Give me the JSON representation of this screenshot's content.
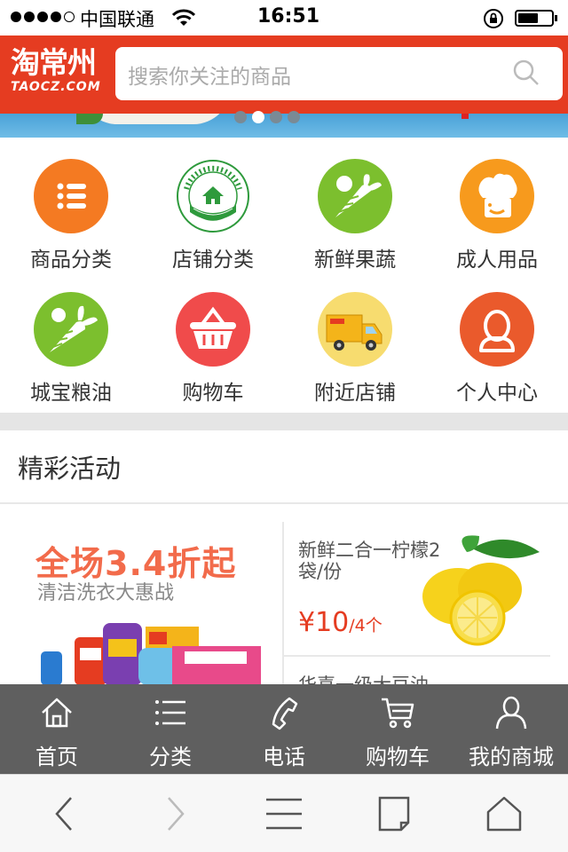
{
  "status_bar": {
    "carrier": "中国联通",
    "time": "16:51"
  },
  "header": {
    "logo_cn": "淘常州",
    "logo_en": "TAOCZ.COM",
    "search_placeholder": "搜索你关注的商品"
  },
  "banner": {
    "slide_count": 4,
    "active_slide": 2
  },
  "categories": [
    {
      "label": "商品分类",
      "icon": "list-icon",
      "color": "#f47a22"
    },
    {
      "label": "店铺分类",
      "icon": "producing-direct-supply-badge",
      "color": "#2e9a3c",
      "badge_top": "Producing Direct Supply",
      "badge_bottom": "产地直供"
    },
    {
      "label": "新鲜果蔬",
      "icon": "vegetable-icon",
      "color": "#7cbf2e"
    },
    {
      "label": "成人用品",
      "icon": "chef-hat-icon",
      "color": "#f79a1d"
    },
    {
      "label": "城宝粮油",
      "icon": "carrot-icon",
      "color": "#7cbf2e"
    },
    {
      "label": "购物车",
      "icon": "basket-icon",
      "color": "#f04b4b"
    },
    {
      "label": "附近店铺",
      "icon": "delivery-truck-icon",
      "color": "#f7dc6f"
    },
    {
      "label": "个人中心",
      "icon": "user-icon",
      "color": "#ea5a2c"
    }
  ],
  "activities": {
    "title": "精彩活动",
    "left_promo": {
      "headline": "全场3.4折起",
      "subline": "清洁洗衣大惠战"
    },
    "right_promo": {
      "title": "新鲜二合一柠檬2袋/份",
      "price": "¥10",
      "unit": "/4个"
    },
    "right_promo_2": {
      "title": "华喜一级大豆油"
    }
  },
  "tab_bar": [
    {
      "label": "首页",
      "icon": "home-icon"
    },
    {
      "label": "分类",
      "icon": "list-icon"
    },
    {
      "label": "电话",
      "icon": "phone-icon"
    },
    {
      "label": "购物车",
      "icon": "cart-icon"
    },
    {
      "label": "我的商城",
      "icon": "user-icon"
    }
  ],
  "browser_bar": {
    "buttons": [
      "back-icon",
      "forward-icon",
      "menu-icon",
      "tabs-icon",
      "home-icon"
    ]
  }
}
